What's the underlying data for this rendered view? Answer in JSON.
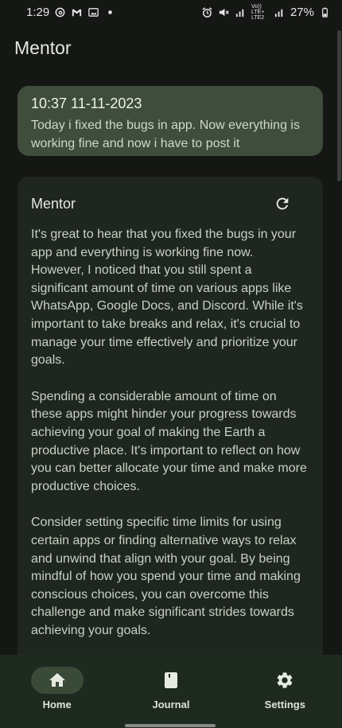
{
  "status_bar": {
    "time": "1:29",
    "battery": "27%",
    "network_label": "Vo)) LTE+ LTE2",
    "icons": [
      "threads-icon",
      "gmail-icon",
      "photo-icon",
      "dot-icon",
      "alarm-icon",
      "mute-icon",
      "signal-icon",
      "signal2-icon",
      "battery-icon"
    ]
  },
  "app_bar": {
    "title": "Mentor"
  },
  "entry": {
    "timestamp": "10:37 11-11-2023",
    "text": "Today i fixed the bugs in app. Now everything is working fine and now i have to post it"
  },
  "mentor": {
    "title": "Mentor",
    "paragraphs": [
      "It's great to hear that you fixed the bugs in your app and everything is working fine now. However, I noticed that you still spent a significant amount of time on various apps like WhatsApp, Google Docs, and Discord. While it's important to take breaks and relax, it's crucial to manage your time effectively and prioritize your goals.",
      "Spending a considerable amount of time on these apps might hinder your progress towards achieving your goal of making the Earth a productive place. It's important to reflect on how you can better allocate your time and make more productive choices.",
      "Consider setting specific time limits for using certain apps or finding alternative ways to relax and unwind that align with your goal. By being mindful of how you spend your time and making conscious choices, you can overcome this challenge and make significant strides towards achieving your goals."
    ]
  },
  "nav": {
    "items": [
      {
        "label": "Home",
        "icon": "home-icon",
        "active": true
      },
      {
        "label": "Journal",
        "icon": "journal-icon",
        "active": false
      },
      {
        "label": "Settings",
        "icon": "settings-icon",
        "active": false
      }
    ]
  },
  "colors": {
    "background": "#151714",
    "entry_card": "#3f4d3d",
    "mentor_card": "#1f2620",
    "nav_bar": "#1e2a1f",
    "nav_active_pill": "#3a4a39"
  }
}
